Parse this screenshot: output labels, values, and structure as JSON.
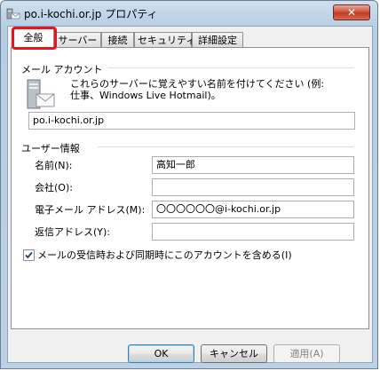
{
  "window": {
    "title": "po.i-kochi.or.jp プロパティ",
    "close_glyph": "✕"
  },
  "tabs": [
    {
      "label": "全般"
    },
    {
      "label": "サーバー"
    },
    {
      "label": "接続"
    },
    {
      "label": "セキュリティ"
    },
    {
      "label": "詳細設定"
    }
  ],
  "account": {
    "group_label": "メール アカウント",
    "description": "これらのサーバーに覚えやすい名前を付けてください (例: 仕事、Windows Live Hotmail)。",
    "name_value": "po.i-kochi.or.jp"
  },
  "user": {
    "group_label": "ユーザー情報",
    "name_label": "名前(N):",
    "name_value": "高知一郎",
    "company_label": "会社(O):",
    "company_value": "",
    "email_label": "電子メール アドレス(M):",
    "email_value": "〇〇〇〇〇〇@i-kochi.or.jp",
    "reply_label": "返信アドレス(Y):",
    "reply_value": ""
  },
  "options": {
    "include_label": "メールの受信時および同期時にこのアカウントを含める(I)",
    "include_checked": true
  },
  "buttons": {
    "ok": "OK",
    "cancel": "キャンセル",
    "apply": "適用(A)"
  },
  "colors": {
    "highlight": "#e8141c",
    "close": "#c23b22"
  }
}
